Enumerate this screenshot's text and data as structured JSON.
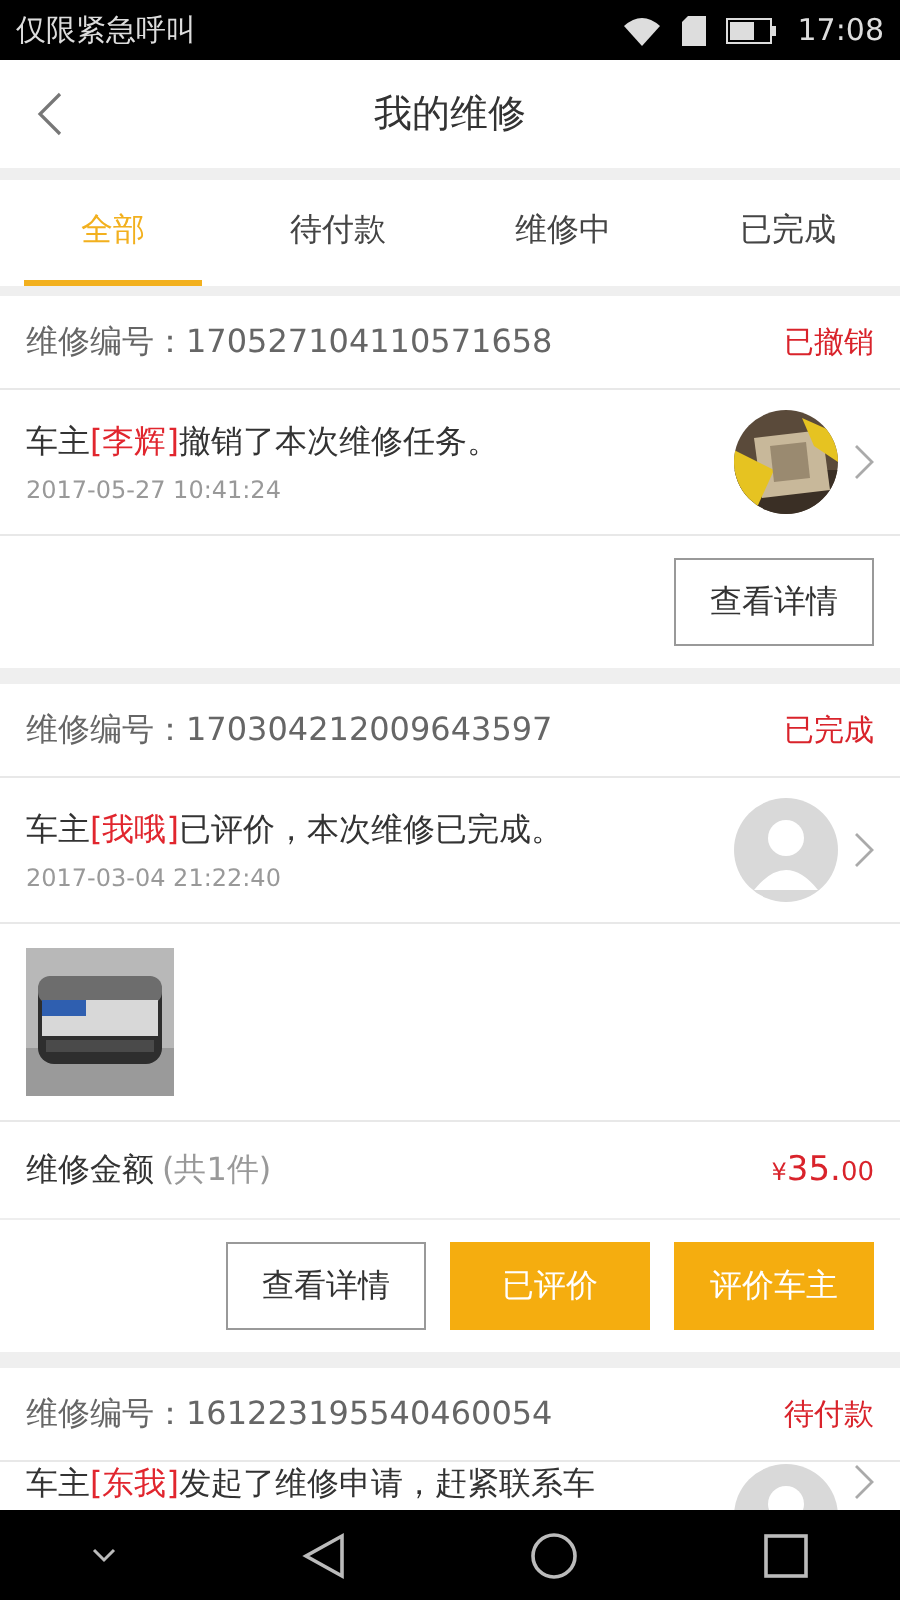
{
  "status_bar": {
    "carrier": "仅限紧急呼叫",
    "time": "17:08"
  },
  "header": {
    "title": "我的维修"
  },
  "tabs": [
    {
      "label": "全部",
      "selected": true
    },
    {
      "label": "待付款",
      "selected": false
    },
    {
      "label": "维修中",
      "selected": false
    },
    {
      "label": "已完成",
      "selected": false
    }
  ],
  "orders": [
    {
      "id_label": "维修编号：",
      "id": "170527104110571658",
      "status": "已撤销",
      "message": {
        "prefix": "车主",
        "owner": "[李辉]",
        "suffix": "撤销了本次维修任务。"
      },
      "time": "2017-05-27 10:41:24",
      "avatar": {
        "kind": "picture"
      },
      "buttons": [
        {
          "label": "查看详情",
          "kind": "outline"
        }
      ]
    },
    {
      "id_label": "维修编号：",
      "id": "170304212009643597",
      "status": "已完成",
      "message": {
        "prefix": "车主",
        "owner": "[我哦]",
        "suffix": "已评价，本次维修已完成。"
      },
      "time": "2017-03-04 21:22:40",
      "avatar": {
        "kind": "default"
      },
      "items": [
        {
          "kind": "picture"
        }
      ],
      "amount": {
        "label": "维修金额",
        "count": "(共1件)",
        "currency": "¥",
        "value": "35.",
        "cents": "00"
      },
      "buttons": [
        {
          "label": "查看详情",
          "kind": "outline"
        },
        {
          "label": "已评价",
          "kind": "filled"
        },
        {
          "label": "评价车主",
          "kind": "filled"
        }
      ]
    },
    {
      "id_label": "维修编号：",
      "id": "161223195540460054",
      "status": "待付款",
      "message": {
        "prefix": "车主",
        "owner": "[东我]",
        "suffix": "发起了维修申请，赶紧联系车"
      },
      "avatar": {
        "kind": "default"
      }
    }
  ]
}
